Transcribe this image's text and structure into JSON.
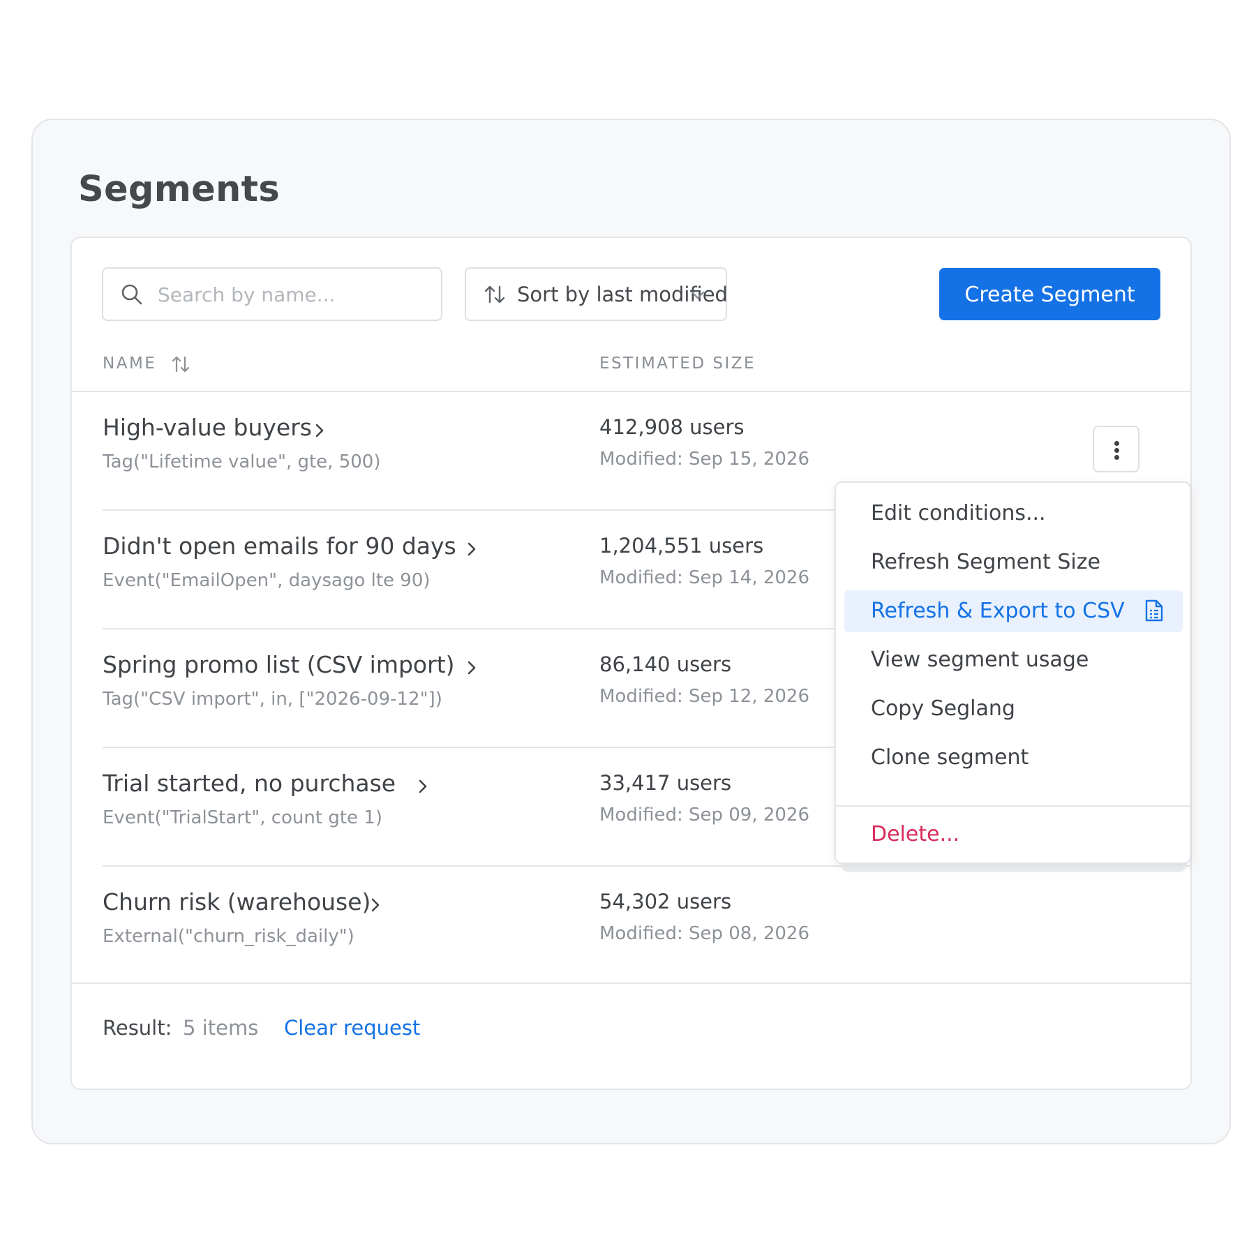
{
  "page": {
    "title": "Segments"
  },
  "toolbar": {
    "search_placeholder": "Search by name...",
    "search_value": "",
    "sort_label": "Sort by last modified",
    "create_label": "Create Segment"
  },
  "table": {
    "columns": {
      "name": "NAME",
      "size": "ESTIMATED SIZE"
    },
    "rows": [
      {
        "name": "High-value buyers",
        "rule": "Tag(\"Lifetime value\", gte, 500)",
        "size": "412,908 users",
        "modified": "Modified: Sep 15, 2026"
      },
      {
        "name": "Didn't open emails for 90 days",
        "rule": "Event(\"EmailOpen\", daysago lte 90)",
        "size": "1,204,551 users",
        "modified": "Modified: Sep 14, 2026"
      },
      {
        "name": "Spring promo list (CSV import)",
        "rule": "Tag(\"CSV import\", in, [\"2026-09-12\"])",
        "size": "86,140 users",
        "modified": "Modified: Sep 12, 2026"
      },
      {
        "name": "Trial started, no purchase",
        "rule": "Event(\"TrialStart\", count gte 1)",
        "size": "33,417 users",
        "modified": "Modified: Sep 09, 2026"
      },
      {
        "name": "Churn risk (warehouse)",
        "rule": "External(\"churn_risk_daily\")",
        "size": "54,302 users",
        "modified": "Modified: Sep 08, 2026"
      }
    ]
  },
  "menu": {
    "items": [
      {
        "label": "Edit conditions..."
      },
      {
        "label": "Refresh Segment Size"
      },
      {
        "label": "Refresh & Export to CSV",
        "active": true,
        "icon": "document-icon"
      },
      {
        "label": "View segment usage"
      },
      {
        "label": "Copy Seglang"
      },
      {
        "label": "Clone segment"
      }
    ],
    "delete_label": "Delete..."
  },
  "footer": {
    "result_label": "Result:",
    "result_count": "5 items",
    "clear_label": "Clear request"
  },
  "colors": {
    "accent": "#1472e6",
    "danger": "#d82a5b",
    "active_bg": "#e8f1fd"
  }
}
